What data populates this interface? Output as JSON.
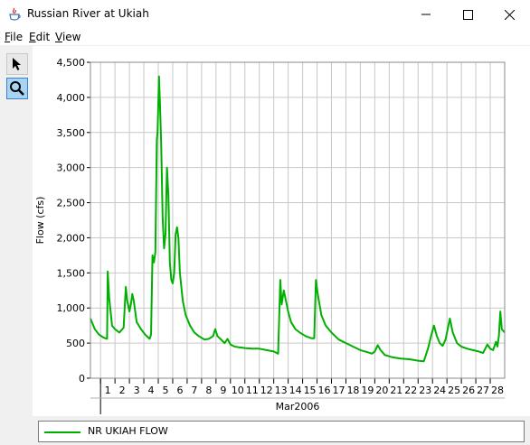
{
  "window": {
    "title": "Russian River at Ukiah"
  },
  "menu": {
    "file": "File",
    "edit": "Edit",
    "view": "View"
  },
  "chart_data": {
    "type": "line",
    "ylabel": "Flow (cfs)",
    "xlabel": "Mar2006",
    "ylim": [
      0,
      4500
    ],
    "y_ticks": [
      "0",
      "500",
      "1,000",
      "1,500",
      "2,000",
      "2,500",
      "3,000",
      "3,500",
      "4,000",
      "4,500"
    ],
    "y_tick_values": [
      0,
      500,
      1000,
      1500,
      2000,
      2500,
      3000,
      3500,
      4000,
      4500
    ],
    "x_ticks": [
      "1",
      "2",
      "3",
      "4",
      "5",
      "6",
      "7",
      "8",
      "9",
      "10",
      "11",
      "12",
      "13",
      "14",
      "15",
      "16",
      "17",
      "18",
      "19",
      "20",
      "21",
      "22",
      "23",
      "24",
      "25",
      "26",
      "27",
      "28"
    ],
    "xlim": [
      0.3,
      29.0
    ],
    "grid": true,
    "series_color": "#00b000",
    "series": [
      {
        "name": "NR UKIAH  FLOW",
        "x": [
          0.3,
          0.6,
          0.9,
          1.2,
          1.45,
          1.5,
          1.6,
          1.8,
          2.0,
          2.3,
          2.6,
          2.75,
          2.85,
          3.0,
          3.1,
          3.2,
          3.3,
          3.5,
          3.8,
          4.1,
          4.4,
          4.5,
          4.6,
          4.7,
          4.8,
          4.9,
          4.95,
          5.05,
          5.12,
          5.2,
          5.3,
          5.4,
          5.5,
          5.6,
          5.7,
          5.8,
          5.9,
          6.0,
          6.1,
          6.2,
          6.3,
          6.4,
          6.5,
          6.6,
          6.7,
          6.8,
          6.9,
          7.0,
          7.2,
          7.5,
          7.8,
          8.2,
          8.5,
          8.8,
          8.95,
          9.1,
          9.3,
          9.6,
          9.8,
          10.0,
          10.3,
          10.6,
          11.0,
          11.5,
          12.0,
          12.5,
          13.0,
          13.3,
          13.45,
          13.55,
          13.7,
          13.85,
          14.0,
          14.2,
          14.5,
          14.8,
          15.2,
          15.6,
          15.8,
          15.92,
          16.05,
          16.3,
          16.6,
          17.0,
          17.5,
          18.0,
          18.5,
          19.0,
          19.5,
          19.8,
          20.0,
          20.2,
          20.4,
          20.7,
          21.2,
          21.8,
          22.4,
          23.0,
          23.4,
          23.7,
          23.9,
          24.1,
          24.3,
          24.5,
          24.7,
          24.9,
          25.0,
          25.2,
          25.4,
          25.7,
          26.0,
          26.4,
          26.8,
          27.2,
          27.5,
          27.8,
          28.0,
          28.2,
          28.4,
          28.5,
          28.6,
          28.7,
          28.8,
          29.0
        ],
        "values": [
          850,
          700,
          620,
          580,
          560,
          1520,
          1150,
          750,
          700,
          650,
          720,
          1300,
          1100,
          950,
          1050,
          1200,
          1100,
          800,
          700,
          620,
          560,
          620,
          1750,
          1650,
          1800,
          3400,
          3500,
          4300,
          3900,
          3350,
          2300,
          1850,
          2050,
          3000,
          2600,
          1650,
          1400,
          1350,
          1500,
          2050,
          2150,
          2000,
          1500,
          1300,
          1100,
          1000,
          900,
          850,
          750,
          650,
          600,
          550,
          560,
          600,
          700,
          600,
          560,
          500,
          560,
          480,
          450,
          440,
          430,
          420,
          420,
          400,
          380,
          350,
          1400,
          1050,
          1250,
          1100,
          950,
          800,
          700,
          650,
          600,
          570,
          570,
          1400,
          1200,
          900,
          750,
          650,
          550,
          500,
          450,
          400,
          370,
          350,
          380,
          470,
          400,
          330,
          300,
          280,
          270,
          250,
          240,
          430,
          600,
          750,
          600,
          500,
          460,
          550,
          650,
          850,
          650,
          500,
          450,
          420,
          400,
          380,
          360,
          480,
          420,
          400,
          520,
          450,
          600,
          950,
          700,
          650
        ]
      }
    ]
  }
}
